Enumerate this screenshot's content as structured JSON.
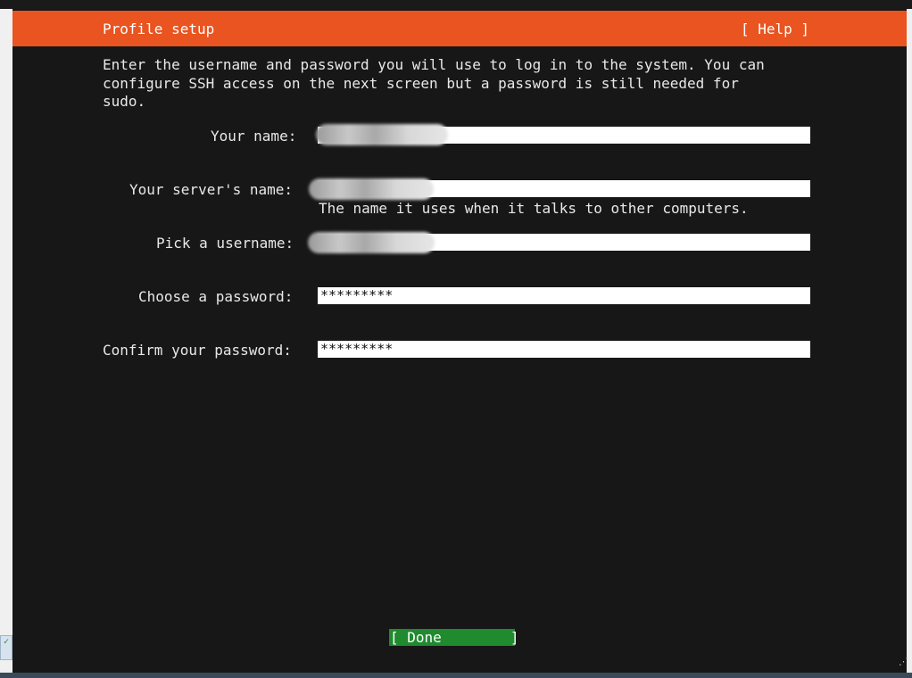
{
  "header": {
    "title": "Profile setup",
    "help": "[ Help ]"
  },
  "intro": "Enter the username and password you will use to log in to the system. You can\nconfigure SSH access on the next screen but a password is still needed for\nsudo.",
  "form": {
    "name_label": "Your name:",
    "server_label": "Your server's name:",
    "server_hint": "The name it uses when it talks to other computers.",
    "username_label": "Pick a username:",
    "password_label": "Choose a password:",
    "password_value": "*********",
    "confirm_label": "Confirm your password:",
    "confirm_value": "*********"
  },
  "done_button": "[ Done        ]",
  "colors": {
    "header": "#e95420",
    "background": "#171717",
    "done": "#1f8a2e"
  }
}
